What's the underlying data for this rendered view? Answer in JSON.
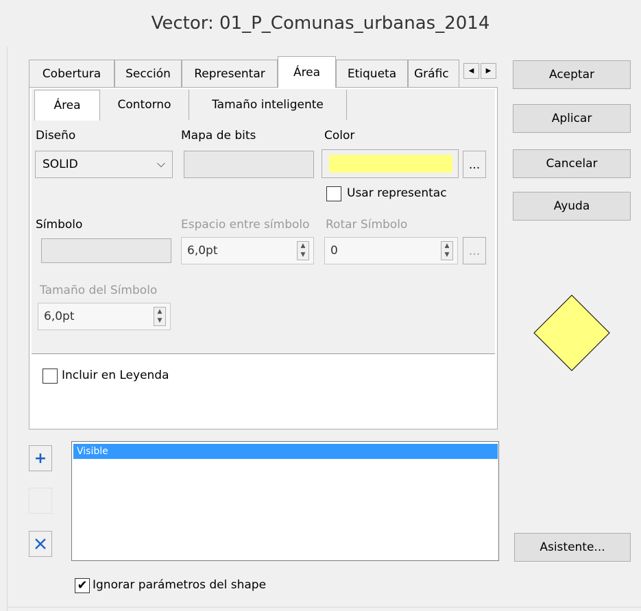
{
  "window": {
    "title": "Vector: 01_P_Comunas_urbanas_2014"
  },
  "tabs": [
    "Cobertura",
    "Sección",
    "Representar",
    "Área",
    "Etiqueta",
    "Gráfic"
  ],
  "subtabs": [
    "Área",
    "Contorno",
    "Tamaño inteligente"
  ],
  "fields": {
    "diseno_label": "Diseño",
    "diseno_value": "SOLID",
    "mapa_label": "Mapa de bits",
    "color_label": "Color",
    "color_value": "#ffff80",
    "usar_label": "Usar representac",
    "simbolo_label": "Símbolo",
    "espacio_label": "Espacio entre símbolo",
    "espacio_value": "6,0pt",
    "rotar_label": "Rotar Símbolo",
    "rotar_value": "0",
    "tamano_label": "Tamaño del Símbolo",
    "tamano_value": "6,0pt",
    "dots": "..."
  },
  "legend": {
    "label": "Incluir en Leyenda",
    "checked": false
  },
  "buttons": {
    "aceptar": "Aceptar",
    "aplicar": "Aplicar",
    "cancelar": "Cancelar",
    "ayuda": "Ayuda",
    "asistente": "Asistente..."
  },
  "list": {
    "items": [
      "Visible"
    ]
  },
  "ignore": {
    "label": "Ignorar parámetros del shape",
    "checked": true
  },
  "preview": {
    "fill": "#ffff80",
    "stroke": "#000000"
  },
  "icons": {
    "add": "plus-icon",
    "delete": "x-icon",
    "left": "arrow-left-icon",
    "right": "arrow-right-icon"
  }
}
